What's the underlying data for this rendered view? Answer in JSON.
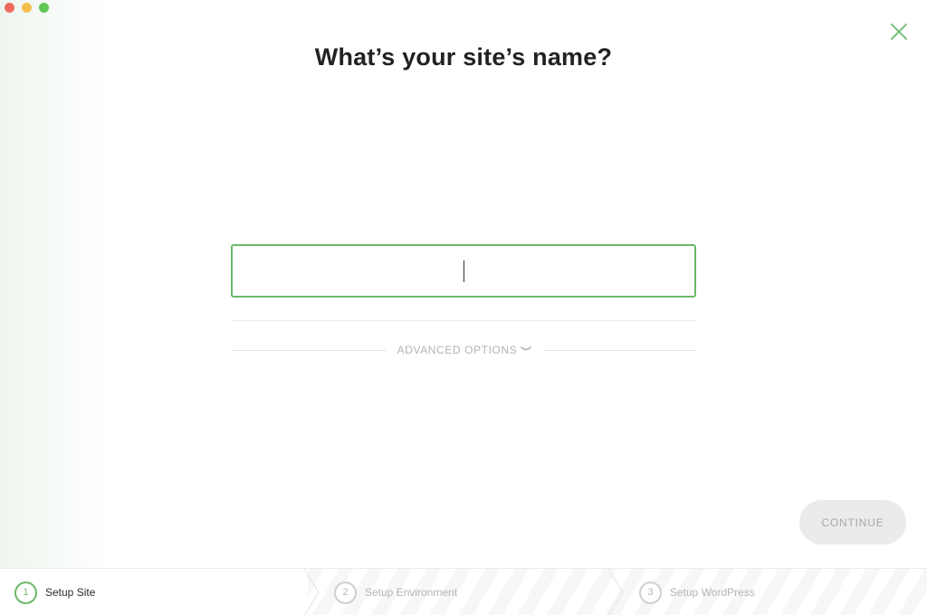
{
  "window": {
    "traffic_lights": {
      "close_color": "#ee6a5e",
      "minimize_color": "#f5bf4f",
      "maximize_color": "#61c554"
    },
    "close_icon": "close-x-icon",
    "accent_color": "#6cb86a"
  },
  "main": {
    "title": "What’s your site’s name?",
    "site_name_input": {
      "value": "",
      "placeholder": ""
    },
    "advanced_options_label": "ADVANCED OPTIONS",
    "advanced_options_icon": "chevron-down-icon",
    "continue_label": "CONTINUE"
  },
  "steps": [
    {
      "number": "1",
      "label": "Setup Site",
      "state": "active"
    },
    {
      "number": "2",
      "label": "Setup Environment",
      "state": "pending"
    },
    {
      "number": "3",
      "label": "Setup WordPress",
      "state": "pending"
    }
  ]
}
